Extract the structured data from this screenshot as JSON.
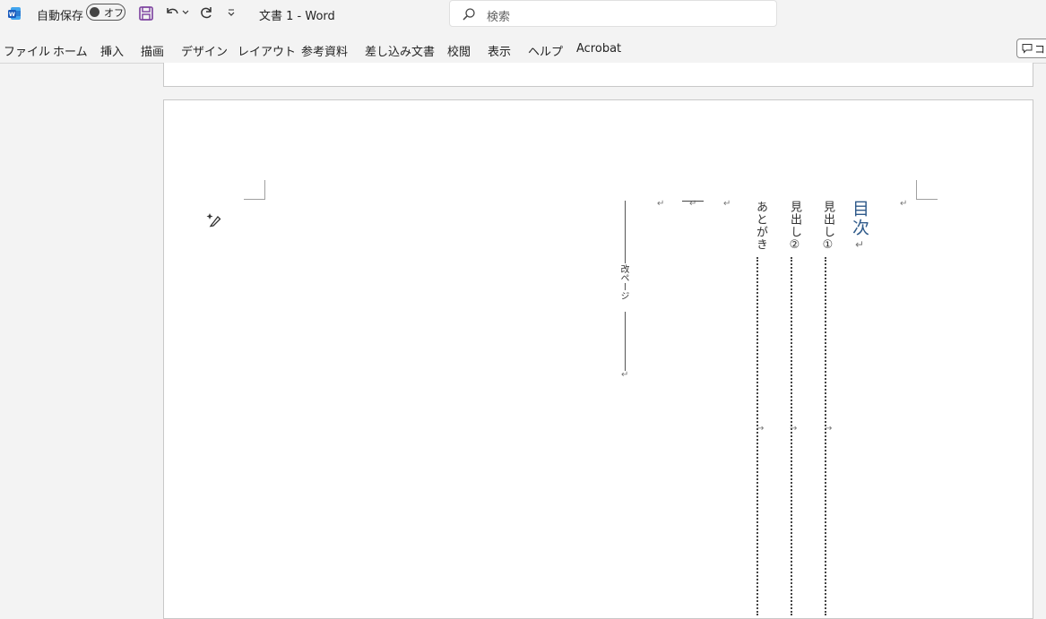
{
  "titlebar": {
    "autosave_label": "自動保存",
    "autosave_state": "オフ",
    "doc_title": "文書 1  -  Word",
    "search_placeholder": "検索",
    "accent_color": "#185abd"
  },
  "menu": {
    "tabs": [
      "ファイル",
      "ホーム",
      "挿入",
      "描画",
      "デザイン",
      "レイアウト",
      "参考資料",
      "差し込み文書",
      "校閲",
      "表示",
      "ヘルプ",
      "Acrobat"
    ],
    "comment_label": "コメント"
  },
  "document": {
    "toc_title": "目次",
    "entries": [
      "見出し①",
      "見出し②",
      "あとがき"
    ],
    "page_break_label": "改ページ",
    "paragraph_mark": "↵",
    "tab_mark": "→",
    "return_mark": "↲"
  }
}
